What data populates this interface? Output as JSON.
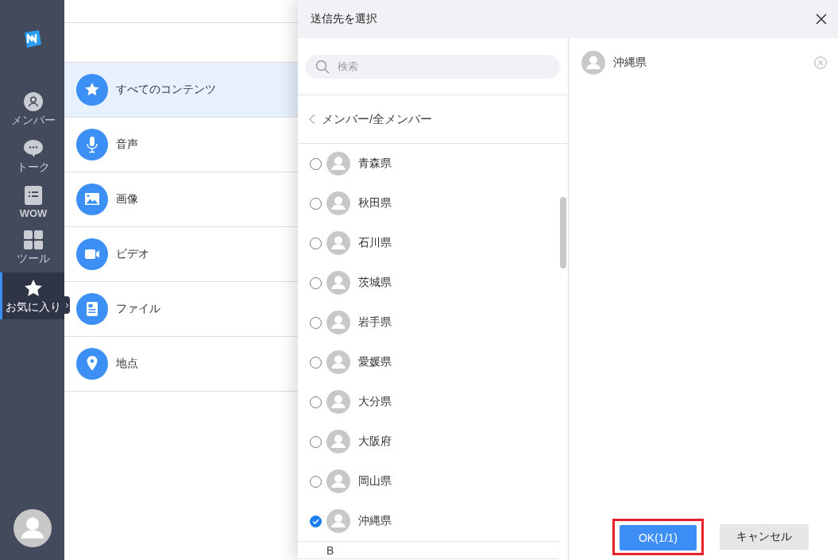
{
  "sidebar": {
    "items": [
      {
        "label": "メンバー",
        "kind": "member",
        "selected": false
      },
      {
        "label": "トーク",
        "kind": "talk",
        "selected": false
      },
      {
        "label": "WOW",
        "kind": "wow",
        "selected": false
      },
      {
        "label": "ツール",
        "kind": "tools",
        "selected": false
      },
      {
        "label": "お気に入り",
        "kind": "favorite",
        "selected": true
      }
    ]
  },
  "categories": [
    {
      "label": "すべてのコンテンツ",
      "kind": "star",
      "selected": true
    },
    {
      "label": "音声",
      "kind": "mic",
      "selected": false
    },
    {
      "label": "画像",
      "kind": "image",
      "selected": false
    },
    {
      "label": "ビデオ",
      "kind": "video",
      "selected": false
    },
    {
      "label": "ファイル",
      "kind": "file",
      "selected": false
    },
    {
      "label": "地点",
      "kind": "pin",
      "selected": false
    }
  ],
  "dialog": {
    "title": "送信先を選択",
    "search": {
      "placeholder": "検索"
    },
    "breadcrumb": "メンバー/全メンバー",
    "members": [
      {
        "name": "青森県",
        "checked": false
      },
      {
        "name": "秋田県",
        "checked": false
      },
      {
        "name": "石川県",
        "checked": false
      },
      {
        "name": "茨城県",
        "checked": false
      },
      {
        "name": "岩手県",
        "checked": false
      },
      {
        "name": "愛媛県",
        "checked": false
      },
      {
        "name": "大分県",
        "checked": false
      },
      {
        "name": "大阪府",
        "checked": false
      },
      {
        "name": "岡山県",
        "checked": false
      },
      {
        "name": "沖縄県",
        "checked": true
      }
    ],
    "section_header": "B",
    "selected_members": [
      {
        "name": "沖縄県"
      }
    ],
    "buttons": [
      {
        "label": "OK(1/1)",
        "kind": "primary",
        "highlighted": true
      },
      {
        "label": "キャンセル",
        "kind": "secondary",
        "highlighted": false
      }
    ]
  }
}
